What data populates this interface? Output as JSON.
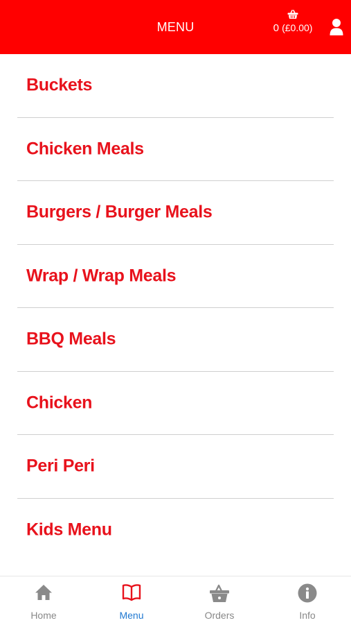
{
  "header": {
    "title": "MENU",
    "cart_count": "0",
    "cart_total": "(£0.00)"
  },
  "menu": {
    "items": [
      {
        "label": "Buckets"
      },
      {
        "label": "Chicken Meals"
      },
      {
        "label": "Burgers / Burger Meals"
      },
      {
        "label": "Wrap / Wrap Meals"
      },
      {
        "label": "BBQ Meals"
      },
      {
        "label": "Chicken"
      },
      {
        "label": "Peri Peri"
      },
      {
        "label": "Kids Menu"
      }
    ]
  },
  "tabbar": {
    "tabs": [
      {
        "label": "Home",
        "icon": "home-icon"
      },
      {
        "label": "Menu",
        "icon": "book-icon",
        "active": true
      },
      {
        "label": "Orders",
        "icon": "basket-icon"
      },
      {
        "label": "Info",
        "icon": "info-icon"
      }
    ]
  },
  "colors": {
    "header_bg": "#ff0000",
    "item_text": "#e8121c",
    "active_tab": "#1f78d1",
    "inactive_tab": "#888888"
  }
}
